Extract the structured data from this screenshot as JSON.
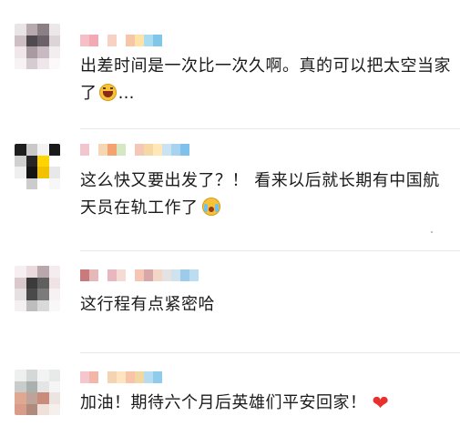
{
  "comments": [
    {
      "text": "出差时间是一次比一次久啊。真的可以把太空当家了",
      "suffix": "…",
      "emoji": "grinning-face-icon",
      "avatar_colors": [
        "#e9e5e6",
        "#b7a9ad",
        "#8a7f84",
        "#ece8ea",
        "#cdbfc4",
        "#4f4950",
        "#6d6168",
        "#ddd4d8",
        "#efe7ea",
        "#a89aa0",
        "#c8bac0",
        "#f2eef0",
        "#f7f3f4",
        "#d6cbd0",
        "#eee6e9",
        "#fbf9fa"
      ],
      "name_colors": [
        "#f6bfc8",
        "#f2a9b4",
        "#ffffff",
        "#f8d0c4",
        "#ffffff",
        "#f5c7a8",
        "#ffe2a8",
        "#a9dcf1",
        "#7fc6e8"
      ]
    },
    {
      "text": "这么快又要出发了？！ 看来以后就长期有中国航天员在轨工作了",
      "emoji": "crying-face-icon",
      "avatar_colors": [
        "#1e1e1e",
        "#c9c9c9",
        "#f3f3f3",
        "#1a1a1a",
        "#d0d0d0",
        "#262626",
        "#ffd400",
        "#ffffff",
        "#efefef",
        "#141414",
        "#f2c200",
        "#e8e8e8",
        "#ffffff",
        "#cccccc",
        "#ffffff",
        "#f7f7f7"
      ],
      "name_colors": [
        "#f3c6cf",
        "#ffffff",
        "#f5d7b3",
        "#f3a36f",
        "#d5e8c3",
        "#ffffff",
        "#f4c7b9",
        "#f6d8a4",
        "#ffe7b8",
        "#c9e3f2",
        "#a7d3ee",
        "#7fc1ea"
      ]
    },
    {
      "text": "这行程有点紧密哈",
      "avatar_colors": [
        "#f6eff1",
        "#ead9dd",
        "#b8a7ab",
        "#f4ecee",
        "#d9c8cc",
        "#3b3b3b",
        "#5f5f5f",
        "#efe3e6",
        "#e5e0e2",
        "#4a4a4a",
        "#7b7b7b",
        "#f7f1f3",
        "#f4f0f1",
        "#bdbdbd",
        "#d9d9d9",
        "#faf7f8"
      ],
      "name_colors": [
        "#c97a7a",
        "#e6b8b8",
        "#ffffff",
        "#e8b7c0",
        "#f4dbd3",
        "#ffffff",
        "#f5c5b5",
        "#d9a7a7",
        "#f4d6c6",
        "#e3e3e3",
        "#cfe2ee",
        "#9ccce9",
        "#bcdcef"
      ]
    },
    {
      "text": "加油！期待六个月后英雄们平安回家！",
      "emoji": "heart-icon",
      "heart": "❤",
      "avatar_colors": [
        "#eef0ef",
        "#d4d8d6",
        "#f2f3f2",
        "#e8eae9",
        "#c8ccca",
        "#a9b0ad",
        "#e3e6e4",
        "#f4f5f4",
        "#e0a890",
        "#bda39a",
        "#c98b7a",
        "#ece4e1",
        "#d99b8a",
        "#b08a7a",
        "#f0e0da",
        "#f6efec"
      ],
      "name_colors": [
        "#f6c6cf",
        "#f2b7a8",
        "#ffffff",
        "#f5d4b4",
        "#ffe4bf",
        "#f7c4a9",
        "#f2d7a3",
        "#b5dcef",
        "#8fcbea"
      ]
    }
  ]
}
